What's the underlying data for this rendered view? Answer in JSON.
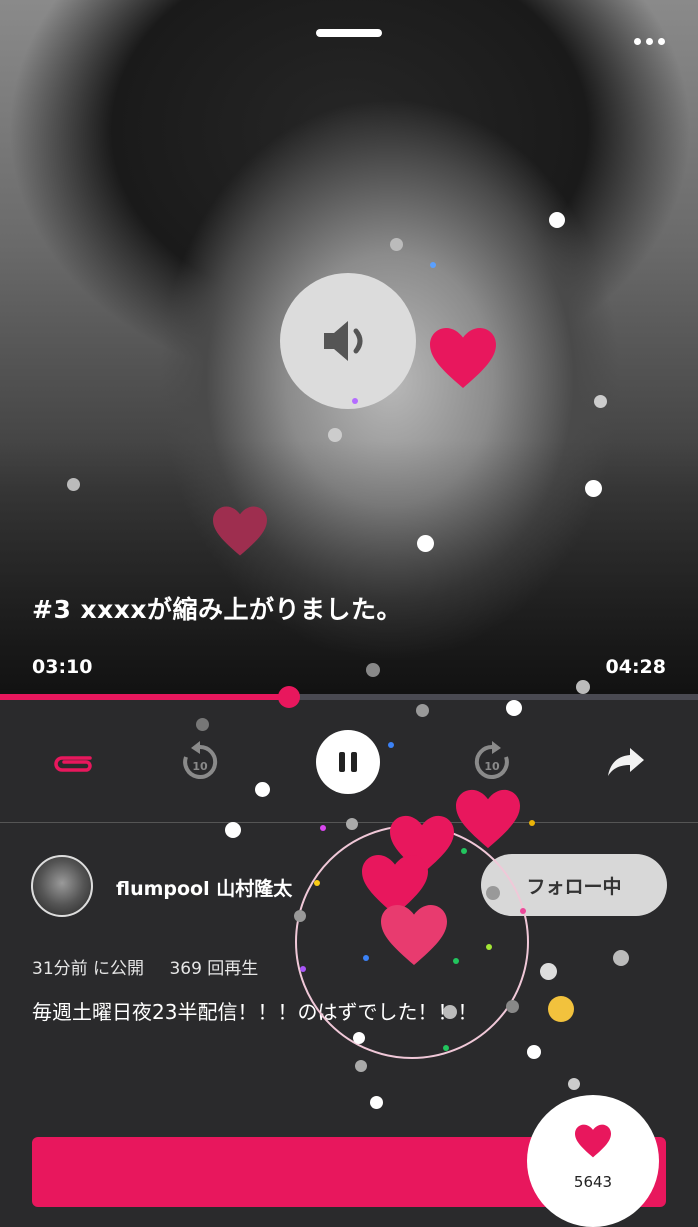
{
  "episode": {
    "title": "#3 xxxxが縮み上がりました。",
    "elapsed": "03:10",
    "duration": "04:28",
    "progress_fraction": 0.414
  },
  "controls": {
    "clip": "clip-icon",
    "rewind": "10",
    "play_state": "pause-icon",
    "forward": "10",
    "share": "share-icon"
  },
  "user": {
    "name": "flumpool 山村隆太",
    "follow_label": "フォロー中"
  },
  "stats": {
    "published": "31分前 に公開",
    "plays": "369 回再生"
  },
  "description": "毎週土曜日夜23半配信！！！のはずでした！！！",
  "like": {
    "count": "5643"
  },
  "colors": {
    "accent": "#e8175d",
    "background": "#2a2a2c"
  }
}
